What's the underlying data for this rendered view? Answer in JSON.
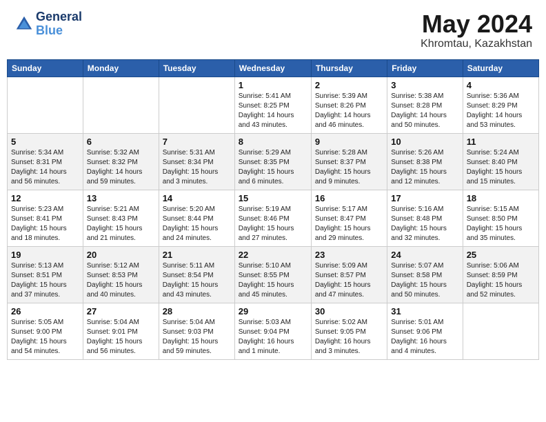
{
  "header": {
    "logo_line1": "General",
    "logo_line2": "Blue",
    "month_year": "May 2024",
    "location": "Khromtau, Kazakhstan"
  },
  "days_of_week": [
    "Sunday",
    "Monday",
    "Tuesday",
    "Wednesday",
    "Thursday",
    "Friday",
    "Saturday"
  ],
  "weeks": [
    [
      {
        "day": "",
        "info": ""
      },
      {
        "day": "",
        "info": ""
      },
      {
        "day": "",
        "info": ""
      },
      {
        "day": "1",
        "info": "Sunrise: 5:41 AM\nSunset: 8:25 PM\nDaylight: 14 hours\nand 43 minutes."
      },
      {
        "day": "2",
        "info": "Sunrise: 5:39 AM\nSunset: 8:26 PM\nDaylight: 14 hours\nand 46 minutes."
      },
      {
        "day": "3",
        "info": "Sunrise: 5:38 AM\nSunset: 8:28 PM\nDaylight: 14 hours\nand 50 minutes."
      },
      {
        "day": "4",
        "info": "Sunrise: 5:36 AM\nSunset: 8:29 PM\nDaylight: 14 hours\nand 53 minutes."
      }
    ],
    [
      {
        "day": "5",
        "info": "Sunrise: 5:34 AM\nSunset: 8:31 PM\nDaylight: 14 hours\nand 56 minutes."
      },
      {
        "day": "6",
        "info": "Sunrise: 5:32 AM\nSunset: 8:32 PM\nDaylight: 14 hours\nand 59 minutes."
      },
      {
        "day": "7",
        "info": "Sunrise: 5:31 AM\nSunset: 8:34 PM\nDaylight: 15 hours\nand 3 minutes."
      },
      {
        "day": "8",
        "info": "Sunrise: 5:29 AM\nSunset: 8:35 PM\nDaylight: 15 hours\nand 6 minutes."
      },
      {
        "day": "9",
        "info": "Sunrise: 5:28 AM\nSunset: 8:37 PM\nDaylight: 15 hours\nand 9 minutes."
      },
      {
        "day": "10",
        "info": "Sunrise: 5:26 AM\nSunset: 8:38 PM\nDaylight: 15 hours\nand 12 minutes."
      },
      {
        "day": "11",
        "info": "Sunrise: 5:24 AM\nSunset: 8:40 PM\nDaylight: 15 hours\nand 15 minutes."
      }
    ],
    [
      {
        "day": "12",
        "info": "Sunrise: 5:23 AM\nSunset: 8:41 PM\nDaylight: 15 hours\nand 18 minutes."
      },
      {
        "day": "13",
        "info": "Sunrise: 5:21 AM\nSunset: 8:43 PM\nDaylight: 15 hours\nand 21 minutes."
      },
      {
        "day": "14",
        "info": "Sunrise: 5:20 AM\nSunset: 8:44 PM\nDaylight: 15 hours\nand 24 minutes."
      },
      {
        "day": "15",
        "info": "Sunrise: 5:19 AM\nSunset: 8:46 PM\nDaylight: 15 hours\nand 27 minutes."
      },
      {
        "day": "16",
        "info": "Sunrise: 5:17 AM\nSunset: 8:47 PM\nDaylight: 15 hours\nand 29 minutes."
      },
      {
        "day": "17",
        "info": "Sunrise: 5:16 AM\nSunset: 8:48 PM\nDaylight: 15 hours\nand 32 minutes."
      },
      {
        "day": "18",
        "info": "Sunrise: 5:15 AM\nSunset: 8:50 PM\nDaylight: 15 hours\nand 35 minutes."
      }
    ],
    [
      {
        "day": "19",
        "info": "Sunrise: 5:13 AM\nSunset: 8:51 PM\nDaylight: 15 hours\nand 37 minutes."
      },
      {
        "day": "20",
        "info": "Sunrise: 5:12 AM\nSunset: 8:53 PM\nDaylight: 15 hours\nand 40 minutes."
      },
      {
        "day": "21",
        "info": "Sunrise: 5:11 AM\nSunset: 8:54 PM\nDaylight: 15 hours\nand 43 minutes."
      },
      {
        "day": "22",
        "info": "Sunrise: 5:10 AM\nSunset: 8:55 PM\nDaylight: 15 hours\nand 45 minutes."
      },
      {
        "day": "23",
        "info": "Sunrise: 5:09 AM\nSunset: 8:57 PM\nDaylight: 15 hours\nand 47 minutes."
      },
      {
        "day": "24",
        "info": "Sunrise: 5:07 AM\nSunset: 8:58 PM\nDaylight: 15 hours\nand 50 minutes."
      },
      {
        "day": "25",
        "info": "Sunrise: 5:06 AM\nSunset: 8:59 PM\nDaylight: 15 hours\nand 52 minutes."
      }
    ],
    [
      {
        "day": "26",
        "info": "Sunrise: 5:05 AM\nSunset: 9:00 PM\nDaylight: 15 hours\nand 54 minutes."
      },
      {
        "day": "27",
        "info": "Sunrise: 5:04 AM\nSunset: 9:01 PM\nDaylight: 15 hours\nand 56 minutes."
      },
      {
        "day": "28",
        "info": "Sunrise: 5:04 AM\nSunset: 9:03 PM\nDaylight: 15 hours\nand 59 minutes."
      },
      {
        "day": "29",
        "info": "Sunrise: 5:03 AM\nSunset: 9:04 PM\nDaylight: 16 hours\nand 1 minute."
      },
      {
        "day": "30",
        "info": "Sunrise: 5:02 AM\nSunset: 9:05 PM\nDaylight: 16 hours\nand 3 minutes."
      },
      {
        "day": "31",
        "info": "Sunrise: 5:01 AM\nSunset: 9:06 PM\nDaylight: 16 hours\nand 4 minutes."
      },
      {
        "day": "",
        "info": ""
      }
    ]
  ]
}
